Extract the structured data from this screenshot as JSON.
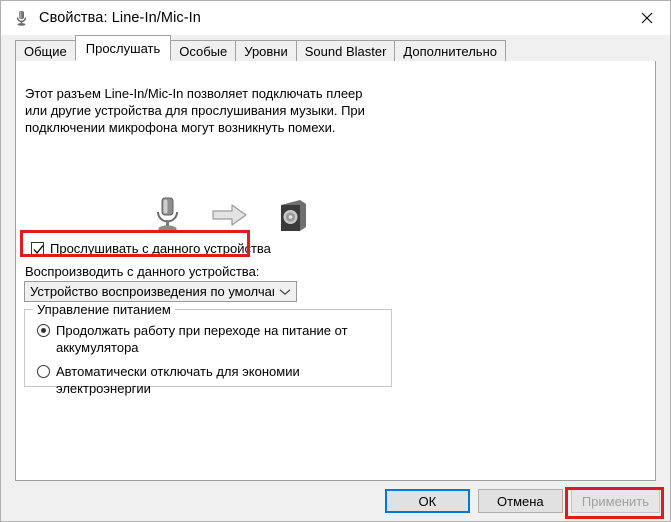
{
  "window": {
    "title": "Свойства: Line-In/Mic-In",
    "title_icon": "microphone-icon",
    "close_label": "✕"
  },
  "tabs": [
    {
      "label": "Общие",
      "active": false
    },
    {
      "label": "Прослушать",
      "active": true
    },
    {
      "label": "Особые",
      "active": false
    },
    {
      "label": "Уровни",
      "active": false
    },
    {
      "label": "Sound Blaster",
      "active": false
    },
    {
      "label": "Дополнительно",
      "active": false
    }
  ],
  "panel": {
    "description": "Этот разъем Line-In/Mic-In позволяет подключать плеер или другие устройства для прослушивания музыки. При подключении микрофона могут возникнуть помехи.",
    "devices": {
      "source_icon": "microphone-icon",
      "flow_icon": "arrow-right-icon",
      "target_icon": "speaker-icon"
    },
    "listen_checkbox": {
      "label": "Прослушивать с данного устройства",
      "checked": true,
      "icon": "checkmark-icon"
    },
    "playback": {
      "label": "Воспроизводить с данного устройства:",
      "selected": "Устройство воспроизведения по умолчанию",
      "arrow_icon": "chevron-down-icon"
    },
    "power_group": {
      "title": "Управление питанием",
      "options": [
        {
          "label": "Продолжать работу при переходе на питание от аккумулятора",
          "selected": true
        },
        {
          "label": "Автоматически отключать для экономии электроэнергии",
          "selected": false
        }
      ]
    }
  },
  "footer": {
    "ok": "ОК",
    "cancel": "Отмена",
    "apply": "Применить",
    "apply_disabled": true
  },
  "annotations": {
    "color": "#e01b1b",
    "targets": [
      "listen-checkbox",
      "apply-button"
    ]
  }
}
